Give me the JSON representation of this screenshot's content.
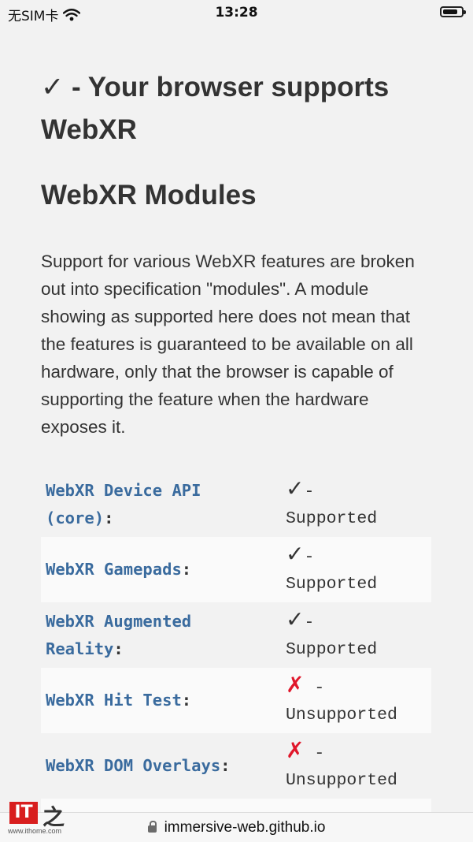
{
  "status_bar": {
    "carrier": "无SIM卡",
    "time": "13:28"
  },
  "page": {
    "support_heading": {
      "check": "✓",
      "text": " - Your browser supports WebXR"
    },
    "modules_heading": "WebXR Modules",
    "description": "Support for various WebXR features are broken out into specification \"modules\". A module showing as supported here does not mean that the features is guaranteed to be available on all hardware, only that the browser is capable of supporting the feature when the hardware exposes it.",
    "modules": [
      {
        "name": "WebXR Device API (core)",
        "icon": "✓",
        "separator": "-",
        "status": "Supported"
      },
      {
        "name": "WebXR Gamepads",
        "icon": "✓",
        "separator": "-",
        "status": "Supported"
      },
      {
        "name": "WebXR Augmented Reality",
        "icon": "✓",
        "separator": "-",
        "status": "Supported"
      },
      {
        "name": "WebXR Hit Test",
        "icon": "✗",
        "separator": " -",
        "status": "Unsupported"
      },
      {
        "name": "WebXR DOM Overlays",
        "icon": "✗",
        "separator": " -",
        "status": "Unsupported"
      },
      {
        "name": "",
        "icon": "✗",
        "separator": "",
        "status": ""
      }
    ]
  },
  "url_bar": {
    "url": "immersive-web.github.io"
  },
  "watermark": {
    "logo": "IT",
    "char": "之",
    "url": "www.ithome.com"
  },
  "colors": {
    "module_name": "#3a6b9e",
    "unsupported_icon": "#e0172b",
    "background": "#f2f2f2"
  }
}
